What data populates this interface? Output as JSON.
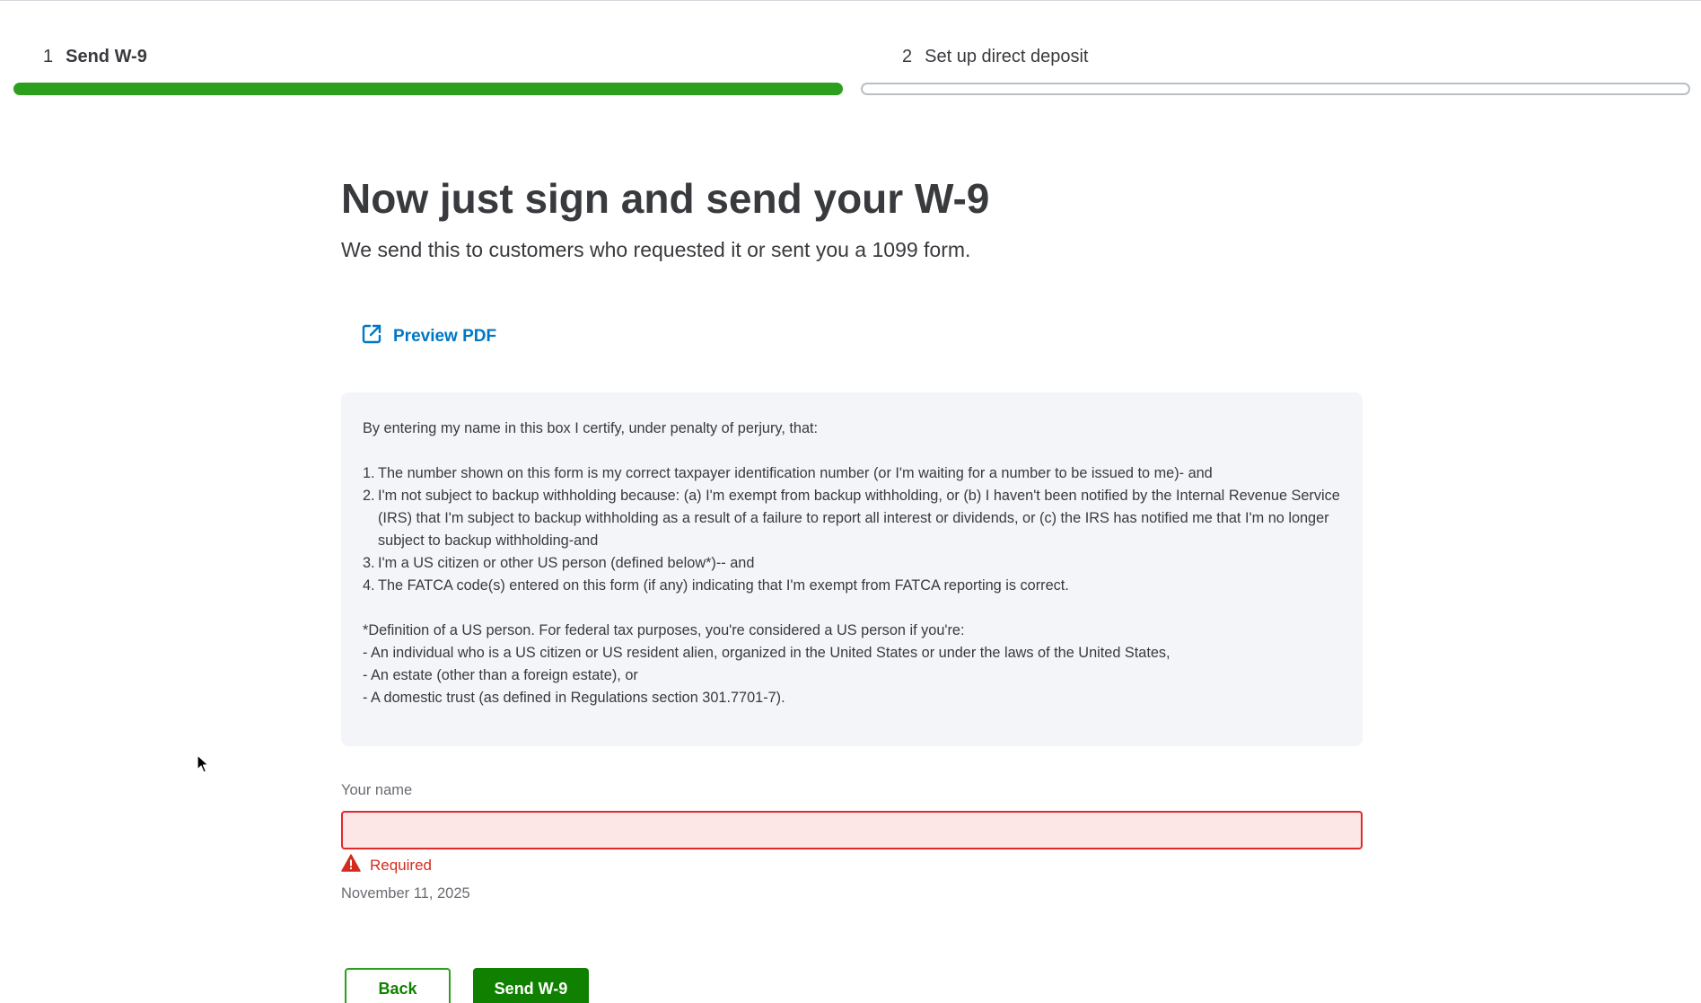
{
  "stepper": {
    "steps": [
      {
        "number": "1",
        "label": "Send W-9",
        "state": "complete"
      },
      {
        "number": "2",
        "label": "Set up direct deposit",
        "state": "upcoming"
      }
    ]
  },
  "main": {
    "title": "Now just sign and send your W-9",
    "subtitle": "We send this to customers who requested it or sent you a 1099 form.",
    "preview_link": "Preview PDF"
  },
  "certification": {
    "intro": "By entering my name in this box I certify, under penalty of perjury, that:",
    "items": [
      {
        "num": "1.",
        "text": "The number shown on this form is my correct taxpayer identification number (or I'm waiting for a number to be issued to me)- and"
      },
      {
        "num": "2.",
        "text": "I'm not subject to backup withholding because: (a) I'm exempt from backup withholding, or (b) I haven't been notified by the Internal Revenue Service (IRS) that I'm subject to backup withholding as a result of a failure to report all interest or dividends, or (c) the IRS has notified me that I'm no longer subject to backup withholding-and"
      },
      {
        "num": "3.",
        "text": "I'm a US citizen or other US person (defined below*)-- and"
      },
      {
        "num": "4.",
        "text": "The FATCA code(s) entered on this form (if any) indicating that I'm exempt from FATCA reporting is correct."
      }
    ],
    "definition": {
      "heading": "*Definition of a US person. For federal tax purposes, you're considered a US person if you're:",
      "lines": [
        "- An individual who is a US citizen or US resident alien, organized in the United States or under the laws of the United States,",
        "- An estate (other than a foreign estate), or",
        "- A domestic trust (as defined in Regulations section 301.7701-7)."
      ]
    }
  },
  "signature": {
    "label": "Your name",
    "value": "",
    "placeholder": "",
    "error": "Required",
    "date": "November 11, 2025"
  },
  "actions": {
    "back_label": "Back",
    "send_label": "Send W-9"
  },
  "colors": {
    "progress_complete": "#2ca01c",
    "link": "#0077c5",
    "error": "#d52b1e",
    "primary_button": "#108000"
  }
}
